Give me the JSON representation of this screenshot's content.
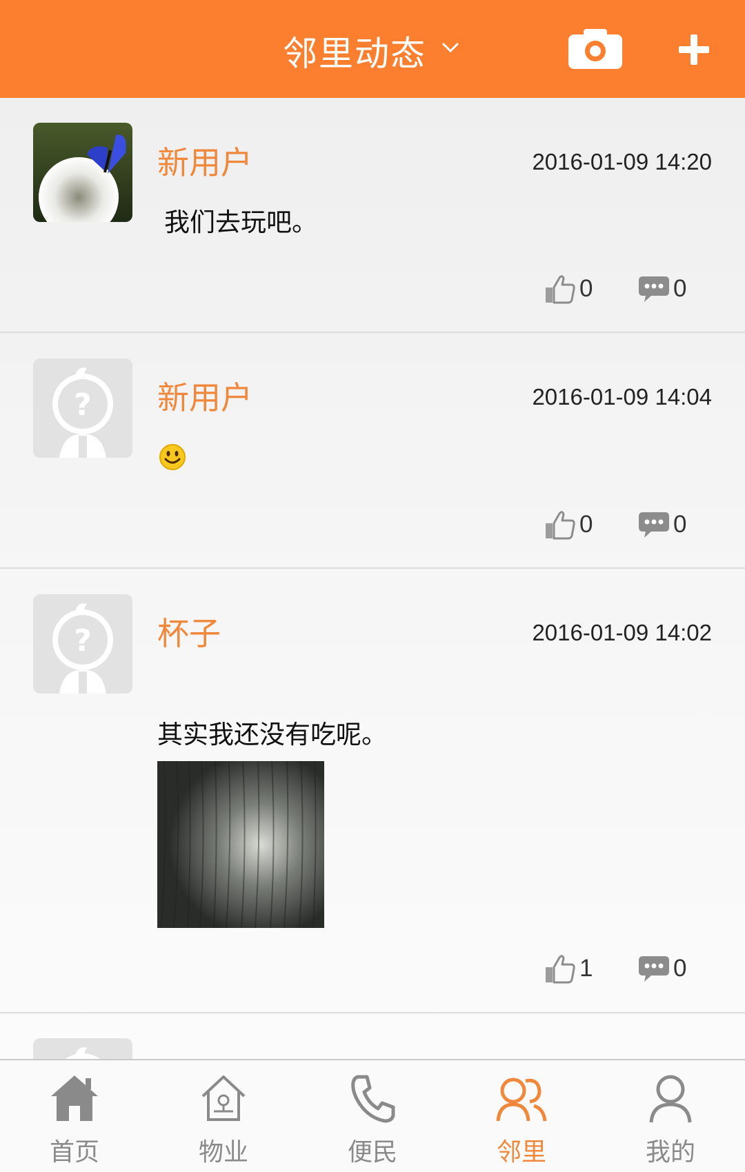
{
  "header": {
    "title": "邻里动态",
    "icons": {
      "dropdown": "chevron-down-icon",
      "camera": "camera-icon",
      "add": "plus-icon"
    },
    "background": "#fb7f2f"
  },
  "posts": [
    {
      "username": "新用户",
      "time": "2016-01-09 14:20",
      "content": "我们去玩吧。",
      "avatar": "butterfly-dandelion-photo",
      "likes": "0",
      "comments": "0"
    },
    {
      "username": "新用户",
      "time": "2016-01-09 14:04",
      "content": "",
      "emoji": "smiley-emoji",
      "avatar": "default-avatar",
      "likes": "0",
      "comments": "0"
    },
    {
      "username": "杯子",
      "time": "2016-01-09 14:02",
      "content": "其实我还没有吃呢。",
      "avatar": "default-avatar",
      "image": "wood-grain-photo",
      "likes": "1",
      "comments": "0"
    }
  ],
  "tabs": [
    {
      "label": "首页",
      "icon": "home-icon",
      "active": false
    },
    {
      "label": "物业",
      "icon": "property-icon",
      "active": false
    },
    {
      "label": "便民",
      "icon": "phone-icon",
      "active": false
    },
    {
      "label": "邻里",
      "icon": "neighbors-icon",
      "active": true
    },
    {
      "label": "我的",
      "icon": "user-icon",
      "active": false
    }
  ],
  "colors": {
    "accent": "#fb7f2f",
    "username": "#f0883c",
    "inactive": "#8a8a8a"
  }
}
